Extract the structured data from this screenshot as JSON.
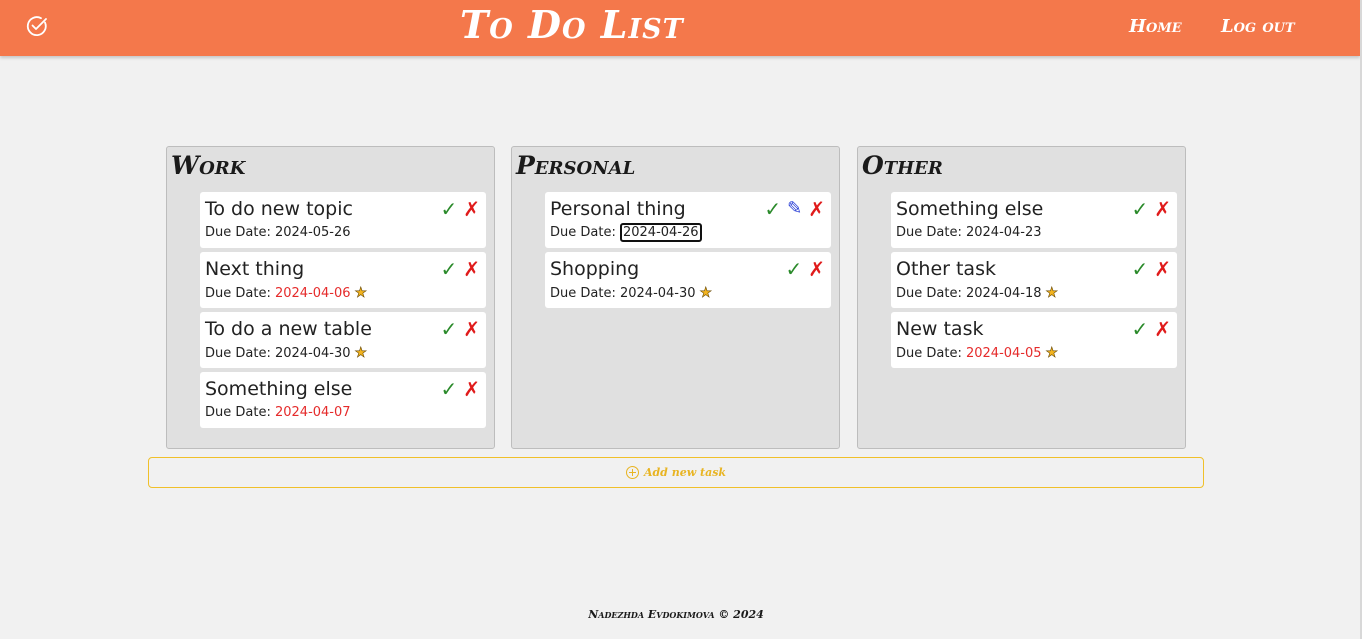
{
  "header": {
    "title": "To Do List",
    "logo_icon": "check-circle-icon",
    "nav": [
      {
        "label": "Home"
      },
      {
        "label": "Log out"
      }
    ],
    "color": "#f4784b"
  },
  "columns": [
    {
      "title": "Work",
      "tasks": [
        {
          "name": "To do new topic",
          "due_label": "Due Date:",
          "due": "2024-05-26",
          "overdue": false,
          "starred": false,
          "edit_visible": false
        },
        {
          "name": "Next thing",
          "due_label": "Due Date:",
          "due": "2024-04-06",
          "overdue": true,
          "starred": true,
          "edit_visible": false
        },
        {
          "name": "To do a new table",
          "due_label": "Due Date:",
          "due": "2024-04-30",
          "overdue": false,
          "starred": true,
          "edit_visible": false
        },
        {
          "name": "Something else",
          "due_label": "Due Date:",
          "due": "2024-04-07",
          "overdue": true,
          "starred": false,
          "edit_visible": false
        }
      ]
    },
    {
      "title": "Personal",
      "tasks": [
        {
          "name": "Personal thing",
          "due_label": "Due Date:",
          "due": "2024-04-26",
          "overdue": false,
          "starred": false,
          "edit_visible": true,
          "editing_date": true
        },
        {
          "name": "Shopping",
          "due_label": "Due Date:",
          "due": "2024-04-30",
          "overdue": false,
          "starred": true,
          "edit_visible": false
        }
      ]
    },
    {
      "title": "Other",
      "tasks": [
        {
          "name": "Something else",
          "due_label": "Due Date:",
          "due": "2024-04-23",
          "overdue": false,
          "starred": false,
          "edit_visible": false
        },
        {
          "name": "Other task",
          "due_label": "Due Date:",
          "due": "2024-04-18",
          "overdue": false,
          "starred": true,
          "edit_visible": false
        },
        {
          "name": "New task",
          "due_label": "Due Date:",
          "due": "2024-04-05",
          "overdue": true,
          "starred": true,
          "edit_visible": false
        }
      ]
    }
  ],
  "icons": {
    "done": "✓",
    "delete": "✗",
    "edit": "✎",
    "star": "★"
  },
  "add_task": {
    "label": "Add new task",
    "icon": "plus-circle-icon",
    "accent": "#f0c02a"
  },
  "footer": {
    "text": "Nadezhda Evdokimova © 2024"
  },
  "colors": {
    "overdue": "#e52b2b",
    "done": "#2a8a2a",
    "delete": "#e01b1b",
    "edit": "#2a3fd6",
    "star": "#f3b41f"
  }
}
